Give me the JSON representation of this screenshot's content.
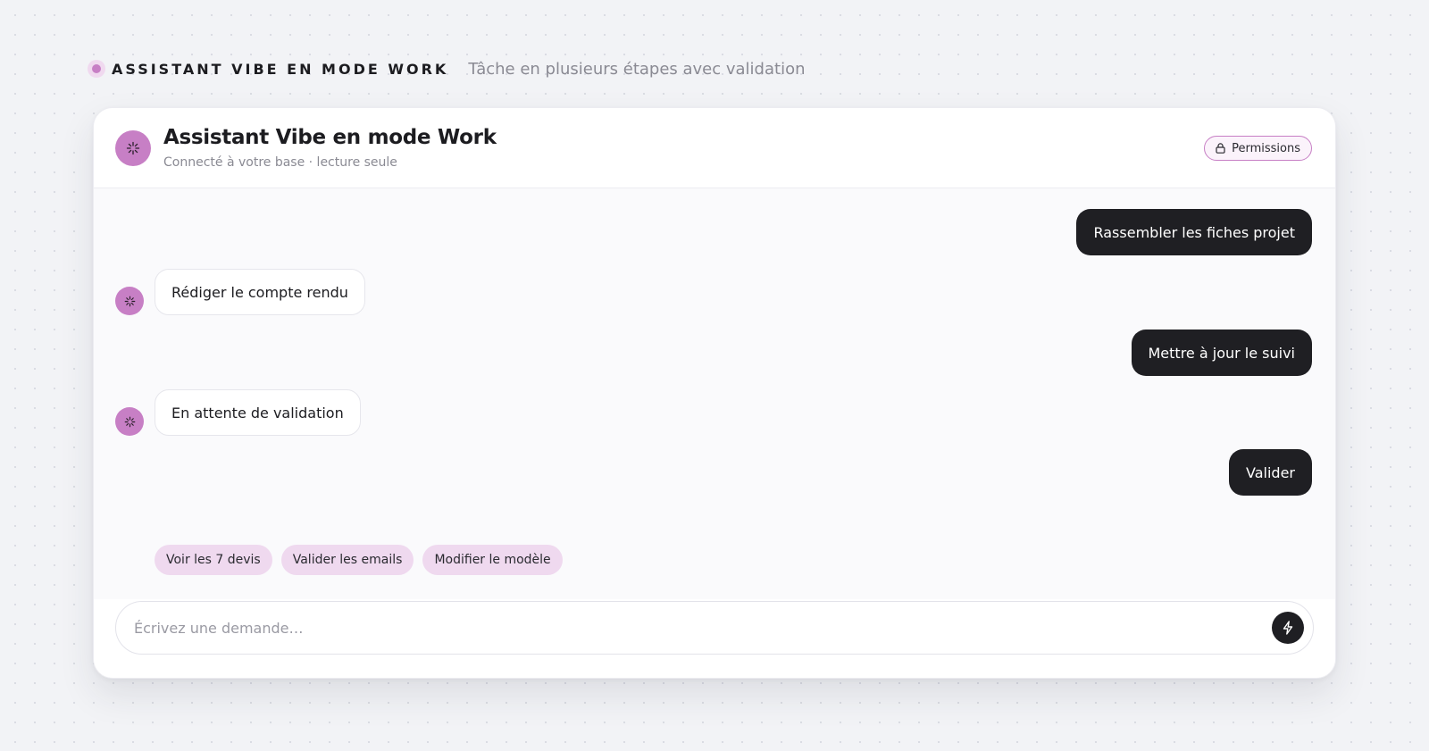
{
  "top": {
    "title": "ASSISTANT VIBE EN MODE WORK",
    "subtitle": "Tâche en plusieurs étapes avec validation"
  },
  "header": {
    "title": "Assistant Vibe en mode Work",
    "subtitle": "Connecté à votre base · lecture seule",
    "permissions_label": "Permissions",
    "icons": {
      "avatar": "sparkle-icon",
      "permissions": "lock-icon"
    }
  },
  "messages": [
    {
      "role": "user",
      "text": "Rassembler les fiches projet"
    },
    {
      "role": "assistant",
      "text": "Rédiger le compte rendu"
    },
    {
      "role": "user",
      "text": "Mettre à jour le suivi"
    },
    {
      "role": "assistant",
      "text": "En attente de validation"
    },
    {
      "role": "user",
      "text": "Valider"
    }
  ],
  "suggestions": [
    "Voir les 7 devis",
    "Valider les emails",
    "Modifier le modèle"
  ],
  "composer": {
    "placeholder": "Écrivez une demande…",
    "send_icon": "lightning-icon"
  },
  "colors": {
    "accent": "#c77fc5",
    "accent_soft": "#efd9ef",
    "user_bubble": "#1f1f23",
    "background": "#f2f3f6"
  }
}
